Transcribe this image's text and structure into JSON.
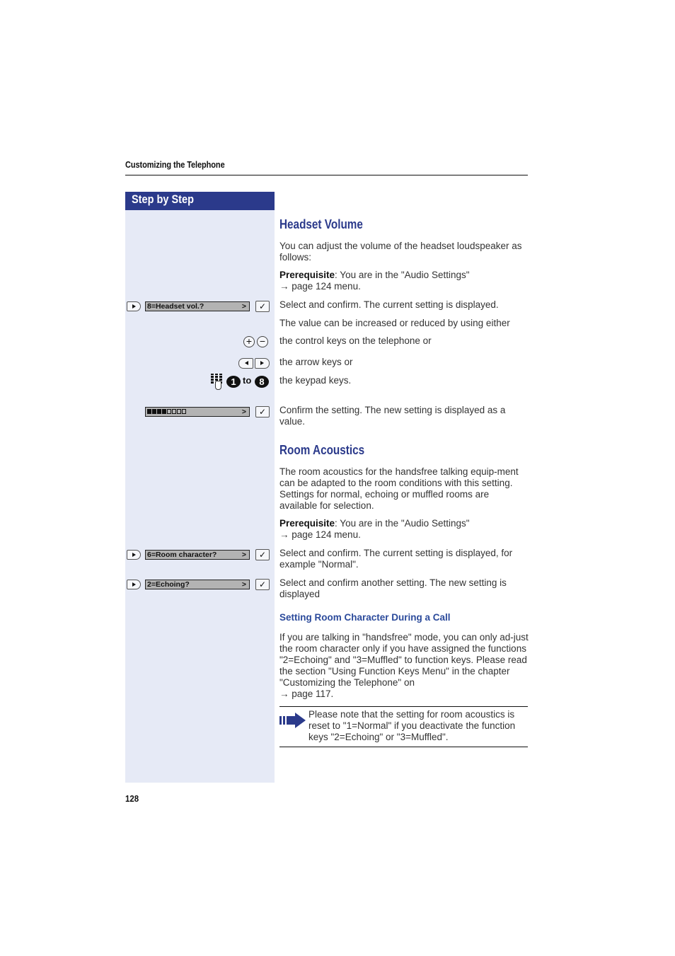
{
  "header": {
    "chapter_title": "Customizing the Telephone"
  },
  "sidebar": {
    "title": "Step by Step"
  },
  "displays": {
    "headset_vol": "8=Headset vol.?",
    "volume_level": {
      "filled": 4,
      "total": 8,
      "level_fraction": 0.5
    },
    "room_character": "6=Room character?",
    "echoing": "2=Echoing?",
    "next_symbol": ">"
  },
  "icons": {
    "select": "select-key",
    "confirm": "✓",
    "plus": "+",
    "minus": "−",
    "keypad_range_from": "1",
    "keypad_range_word": "to",
    "keypad_range_to": "8"
  },
  "sections": {
    "headset_volume": {
      "title": "Headset Volume",
      "intro": "You can adjust the volume of the headset loudspeaker as follows:",
      "prereq_label": "Prerequisite",
      "prereq_text": ": You are in the \"Audio Settings\"",
      "prereq_ref": "→ page 124 menu.",
      "step_select": "Select and confirm. The current setting is displayed.",
      "value_text": "The value can be increased or reduced by using either",
      "control_keys": "the control keys on the telephone or",
      "arrow_keys": "the arrow keys or",
      "keypad_keys": "the keypad keys.",
      "confirm_text": "Confirm the setting. The new setting is displayed as a value."
    },
    "room_acoustics": {
      "title": "Room Acoustics",
      "intro": "The room acoustics for the handsfree talking equip-ment can be adapted to the room conditions with this setting. Settings for normal, echoing or muffled rooms are available for selection.",
      "prereq_label": "Prerequisite",
      "prereq_text": ": You are in the \"Audio Settings\"",
      "prereq_ref": "→ page 124 menu.",
      "step_select": "Select and confirm. The current setting is displayed, for example \"Normal\".",
      "step_another": "Select and confirm another setting. The new setting is displayed"
    },
    "during_call": {
      "title": "Setting Room Character During a Call",
      "body": "If you are talking in \"handsfree\" mode, you can only ad-just the room character only if you have assigned the functions \"2=Echoing\" and \"3=Muffled\" to function keys. Please read the section \"Using Function Keys Menu\" in the chapter \"Customizing the Telephone\" on",
      "ref": "→ page 117.",
      "note": "Please note that the setting for room acoustics is reset to \"1=Normal\" if you deactivate the function keys \"2=Echoing\" or \"3=Muffled\"."
    }
  },
  "footer": {
    "page_number": "128"
  },
  "colors": {
    "brand_blue": "#2b3a8b",
    "sidebar_bg": "#e6eaf6",
    "display_bg": "#b3b3b3"
  }
}
